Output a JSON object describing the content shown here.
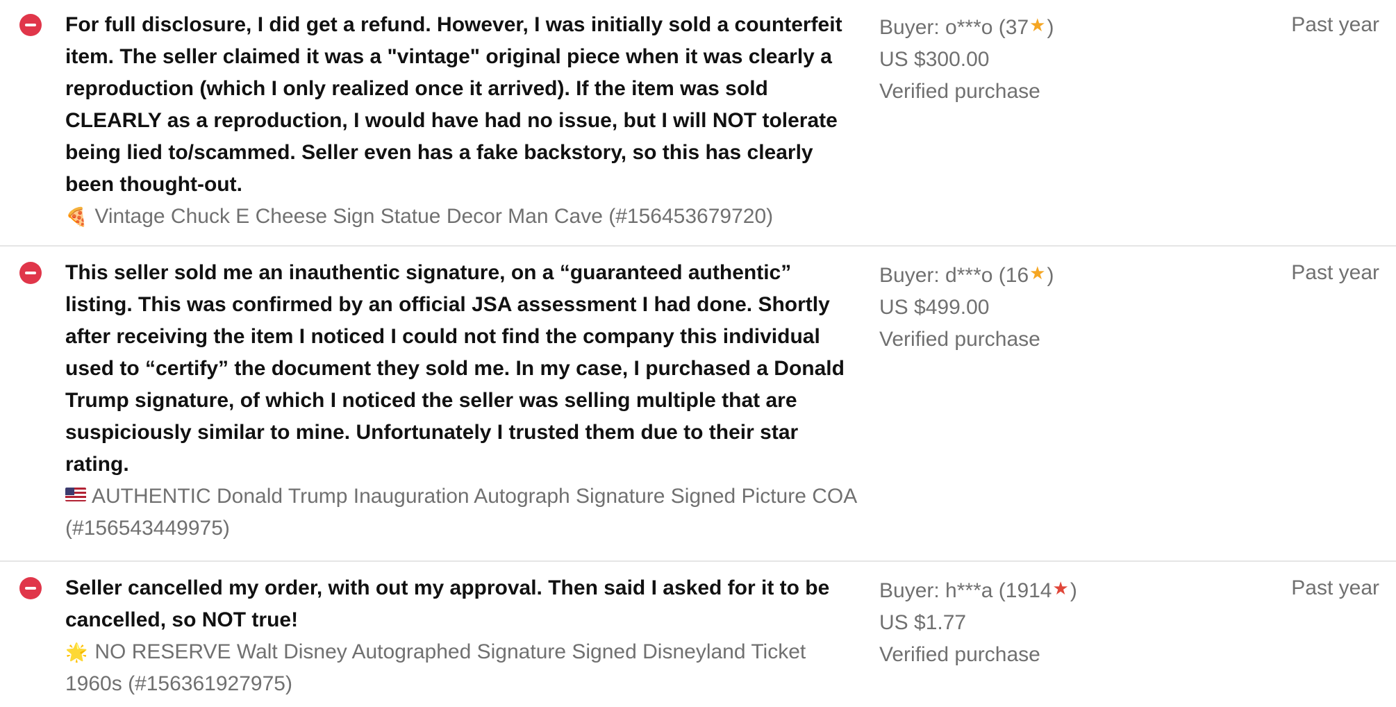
{
  "feedback": [
    {
      "rating_icon": "negative-minus-icon",
      "comment": "For full disclosure, I did get a refund. However, I was initially sold a counterfeit item. The seller claimed it was a \"vintage\" original piece when it was clearly a reproduction (which I only realized once it arrived). If the item was sold CLEARLY as a reproduction, I would have had no issue, but I will NOT tolerate being lied to/scammed. Seller even has a fake backstory, so this has clearly been thought-out.",
      "item_emoji": "🍕",
      "item": "Vintage Chuck E Cheese Sign Statue Decor Man Cave (#156453679720)",
      "buyer_prefix": "Buyer: o***o (37",
      "star": "★",
      "star_color": "#f5a623",
      "buyer_suffix": ")",
      "price": "US $300.00",
      "verified": "Verified purchase",
      "time": "Past year"
    },
    {
      "rating_icon": "negative-minus-icon",
      "comment": "This seller sold me an inauthentic signature, on a “guaranteed authentic” listing. This was confirmed by an official JSA assessment I had done. Shortly after receiving the item I noticed I could not find the company this individual used to “certify” the document they sold me. In my case, I purchased a Donald Trump signature, of which I noticed the seller was selling multiple that are suspiciously similar to mine. Unfortunately I trusted them due to their star rating.",
      "item_emoji": "us-flag-icon",
      "item": "AUTHENTIC Donald Trump Inauguration Autograph Signature Signed Picture COA (#156543449975)",
      "buyer_prefix": "Buyer: d***o (16",
      "star": "★",
      "star_color": "#f5a623",
      "buyer_suffix": ")",
      "price": "US $499.00",
      "verified": "Verified purchase",
      "time": "Past year"
    },
    {
      "rating_icon": "negative-minus-icon",
      "comment": "Seller cancelled my order, with out my approval. Then said I asked for it to be cancelled, so NOT true!",
      "item_emoji": "🌟",
      "item": "NO RESERVE Walt Disney Autographed Signature Signed Disneyland Ticket 1960s (#156361927975)",
      "buyer_prefix": "Buyer: h***a (1914",
      "star": "★",
      "star_color": "#e0473a",
      "buyer_suffix": ")",
      "price": "US $1.77",
      "verified": "Verified purchase",
      "time": "Past year"
    }
  ]
}
